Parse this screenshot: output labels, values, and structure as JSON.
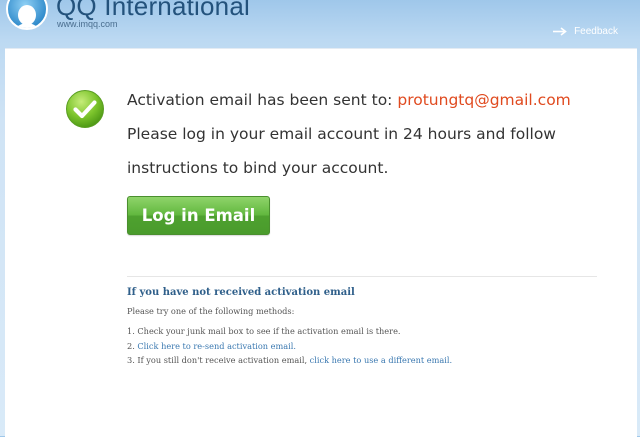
{
  "header": {
    "brand": "QQ International",
    "site_url": "www.imqq.com",
    "feedback_label": "Feedback"
  },
  "message": {
    "sent_prefix": "Activation email has been sent to:",
    "email": "protungtq@gmail.com",
    "line2": "Please log in your email account in 24 hours and follow",
    "line3": "instructions to bind your account."
  },
  "login_button": {
    "label": "Log in Email"
  },
  "help": {
    "title": "If you have not received activation email",
    "subtitle": "Please try one of the following methods:",
    "item1": "1. Check your junk mail box to see if the activation email is there.",
    "item2_prefix": "2. ",
    "item2_link": "Click here to re-send activation email.",
    "item3_prefix": "3. If you still don't receive activation email, ",
    "item3_link": "click here to use a different email."
  },
  "colors": {
    "email": "#e04a1f",
    "button_green": "#5cb23a",
    "link": "#3a78b0",
    "help_title": "#2f5f8a"
  },
  "icons": {
    "logo": "qq-penguin-logo-icon",
    "feedback": "arrow-right-icon",
    "status": "green-check-circle-icon"
  }
}
